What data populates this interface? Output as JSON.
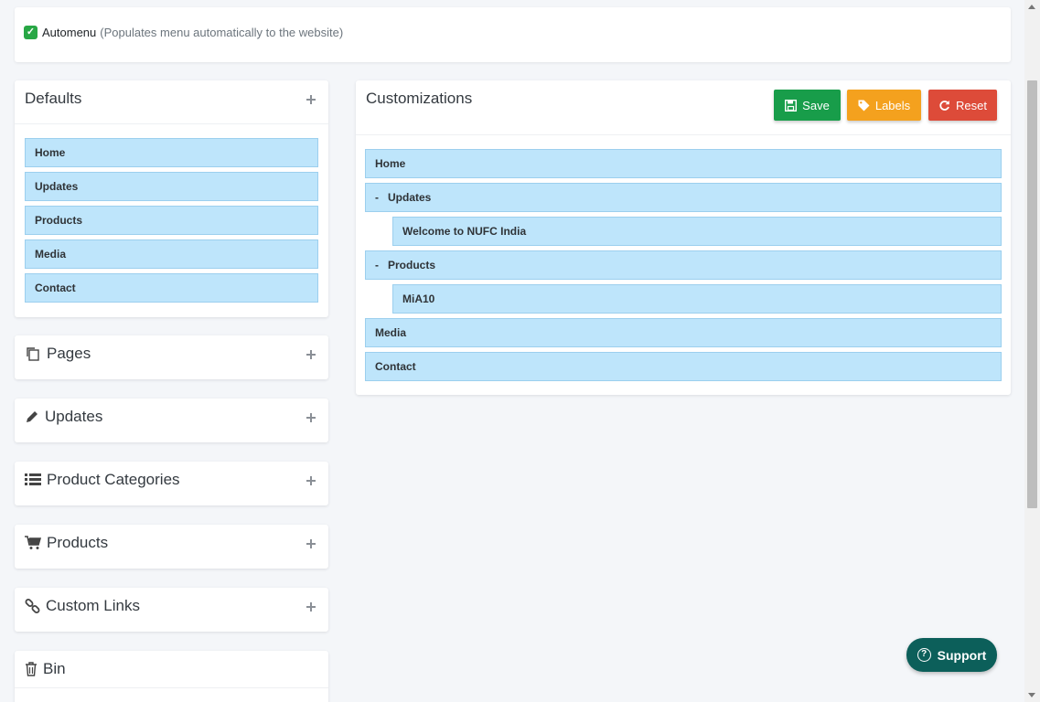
{
  "automenu": {
    "checked": true,
    "label": "Automenu",
    "hint": "(Populates menu automatically to the website)"
  },
  "defaults": {
    "title": "Defaults",
    "items": [
      "Home",
      "Updates",
      "Products",
      "Media",
      "Contact"
    ]
  },
  "panels": [
    {
      "title": "Pages",
      "icon": "copy-icon"
    },
    {
      "title": "Updates",
      "icon": "pencil-icon"
    },
    {
      "title": "Product Categories",
      "icon": "list-icon"
    },
    {
      "title": "Products",
      "icon": "cart-icon"
    },
    {
      "title": "Custom Links",
      "icon": "link-icon"
    },
    {
      "title": "Bin",
      "icon": "trash-icon"
    }
  ],
  "customizations": {
    "title": "Customizations",
    "buttons": {
      "save": "Save",
      "labels": "Labels",
      "reset": "Reset"
    },
    "items": [
      {
        "label": "Home",
        "level": 0,
        "collapse": ""
      },
      {
        "label": "Updates",
        "level": 0,
        "collapse": "-"
      },
      {
        "label": "Welcome to NUFC India",
        "level": 1,
        "collapse": ""
      },
      {
        "label": "Products",
        "level": 0,
        "collapse": "-"
      },
      {
        "label": "MiA10",
        "level": 1,
        "collapse": ""
      },
      {
        "label": "Media",
        "level": 0,
        "collapse": ""
      },
      {
        "label": "Contact",
        "level": 0,
        "collapse": ""
      }
    ]
  },
  "support": {
    "label": "Support"
  },
  "colors": {
    "save": "#189d4a",
    "labels": "#f4a11e",
    "reset": "#dd4b39",
    "menu_item": "#bee5fb",
    "support": "#0c5f5a"
  }
}
